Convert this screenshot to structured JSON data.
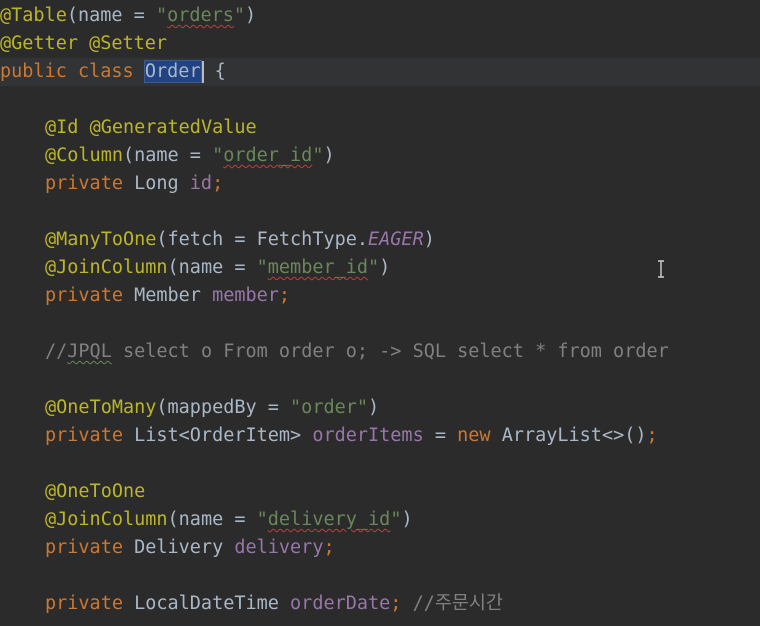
{
  "editor": {
    "lines": [
      {
        "tokens": [
          {
            "t": "@Table",
            "c": "ann"
          },
          {
            "t": "(name = ",
            "c": "plain"
          },
          {
            "t": "\"",
            "c": "str"
          },
          {
            "t": "orders",
            "c": "str squig"
          },
          {
            "t": "\"",
            "c": "str"
          },
          {
            "t": ")",
            "c": "plain"
          }
        ]
      },
      {
        "tokens": [
          {
            "t": "@Getter",
            "c": "ann"
          },
          {
            "t": " ",
            "c": "plain"
          },
          {
            "t": "@Setter",
            "c": "ann"
          }
        ]
      },
      {
        "current": true,
        "tokens": [
          {
            "t": "public",
            "c": "kw"
          },
          {
            "t": " ",
            "c": "plain"
          },
          {
            "t": "class",
            "c": "kw"
          },
          {
            "t": " ",
            "c": "plain"
          },
          {
            "t": "Order",
            "c": "plain sel"
          },
          {
            "caret": true
          },
          {
            "t": " {",
            "c": "plain"
          }
        ]
      },
      {
        "tokens": []
      },
      {
        "indent": true,
        "tokens": [
          {
            "t": "@Id",
            "c": "ann"
          },
          {
            "t": " ",
            "c": "plain"
          },
          {
            "t": "@GeneratedValue",
            "c": "ann"
          }
        ]
      },
      {
        "indent": true,
        "tokens": [
          {
            "t": "@Column",
            "c": "ann"
          },
          {
            "t": "(name = ",
            "c": "plain"
          },
          {
            "t": "\"",
            "c": "str"
          },
          {
            "t": "order_id",
            "c": "str squig"
          },
          {
            "t": "\"",
            "c": "str"
          },
          {
            "t": ")",
            "c": "plain"
          }
        ]
      },
      {
        "indent": true,
        "tokens": [
          {
            "t": "private",
            "c": "kw"
          },
          {
            "t": " Long ",
            "c": "plain"
          },
          {
            "t": "id",
            "c": "fld"
          },
          {
            "t": ";",
            "c": "kw"
          }
        ]
      },
      {
        "tokens": []
      },
      {
        "indent": true,
        "tokens": [
          {
            "t": "@ManyToOne",
            "c": "ann"
          },
          {
            "t": "(fetch = FetchType.",
            "c": "plain"
          },
          {
            "t": "EAGER",
            "c": "enum"
          },
          {
            "t": ")",
            "c": "plain"
          }
        ]
      },
      {
        "indent": true,
        "tokens": [
          {
            "t": "@JoinColumn",
            "c": "ann"
          },
          {
            "t": "(name = ",
            "c": "plain"
          },
          {
            "t": "\"",
            "c": "str"
          },
          {
            "t": "member_id",
            "c": "str squig"
          },
          {
            "t": "\"",
            "c": "str"
          },
          {
            "t": ")",
            "c": "plain"
          }
        ]
      },
      {
        "indent": true,
        "tokens": [
          {
            "t": "private",
            "c": "kw"
          },
          {
            "t": " Member ",
            "c": "plain"
          },
          {
            "t": "member",
            "c": "fld"
          },
          {
            "t": ";",
            "c": "kw"
          }
        ]
      },
      {
        "tokens": []
      },
      {
        "indent": true,
        "tokens": [
          {
            "t": "//",
            "c": "cmt"
          },
          {
            "t": "JPQL",
            "c": "cmt squig-green"
          },
          {
            "t": " select o From order o; -> SQL select * from order",
            "c": "cmt"
          }
        ]
      },
      {
        "tokens": []
      },
      {
        "indent": true,
        "tokens": [
          {
            "t": "@OneToMany",
            "c": "ann"
          },
          {
            "t": "(mappedBy = ",
            "c": "plain"
          },
          {
            "t": "\"order\"",
            "c": "str"
          },
          {
            "t": ")",
            "c": "plain"
          }
        ]
      },
      {
        "indent": true,
        "tokens": [
          {
            "t": "private",
            "c": "kw"
          },
          {
            "t": " List<OrderItem> ",
            "c": "plain"
          },
          {
            "t": "orderItems",
            "c": "fld"
          },
          {
            "t": " = ",
            "c": "plain"
          },
          {
            "t": "new",
            "c": "kw"
          },
          {
            "t": " ArrayList<>()",
            "c": "plain"
          },
          {
            "t": ";",
            "c": "kw"
          }
        ]
      },
      {
        "tokens": []
      },
      {
        "indent": true,
        "tokens": [
          {
            "t": "@OneToOne",
            "c": "ann"
          }
        ]
      },
      {
        "indent": true,
        "tokens": [
          {
            "t": "@JoinColumn",
            "c": "ann"
          },
          {
            "t": "(name = ",
            "c": "plain"
          },
          {
            "t": "\"",
            "c": "str"
          },
          {
            "t": "delivery_id",
            "c": "str squig"
          },
          {
            "t": "\"",
            "c": "str"
          },
          {
            "t": ")",
            "c": "plain"
          }
        ]
      },
      {
        "indent": true,
        "tokens": [
          {
            "t": "private",
            "c": "kw"
          },
          {
            "t": " Delivery ",
            "c": "plain"
          },
          {
            "t": "delivery",
            "c": "fld"
          },
          {
            "t": ";",
            "c": "kw"
          }
        ]
      },
      {
        "tokens": []
      },
      {
        "indent": true,
        "tokens": [
          {
            "t": "private",
            "c": "kw"
          },
          {
            "t": " LocalDateTime ",
            "c": "plain"
          },
          {
            "t": "orderDate",
            "c": "fld"
          },
          {
            "t": ";",
            "c": "kw"
          },
          {
            "t": " //주문시간",
            "c": "cmt"
          }
        ]
      }
    ]
  },
  "cursor_icon": "text-cursor-icon",
  "colors": {
    "background": "#2b2b2b",
    "annotation": "#bbb529",
    "keyword": "#cc7832",
    "string": "#6a8759",
    "field": "#9876aa",
    "comment": "#808080",
    "text": "#a9b7c6",
    "selection": "#214283"
  }
}
